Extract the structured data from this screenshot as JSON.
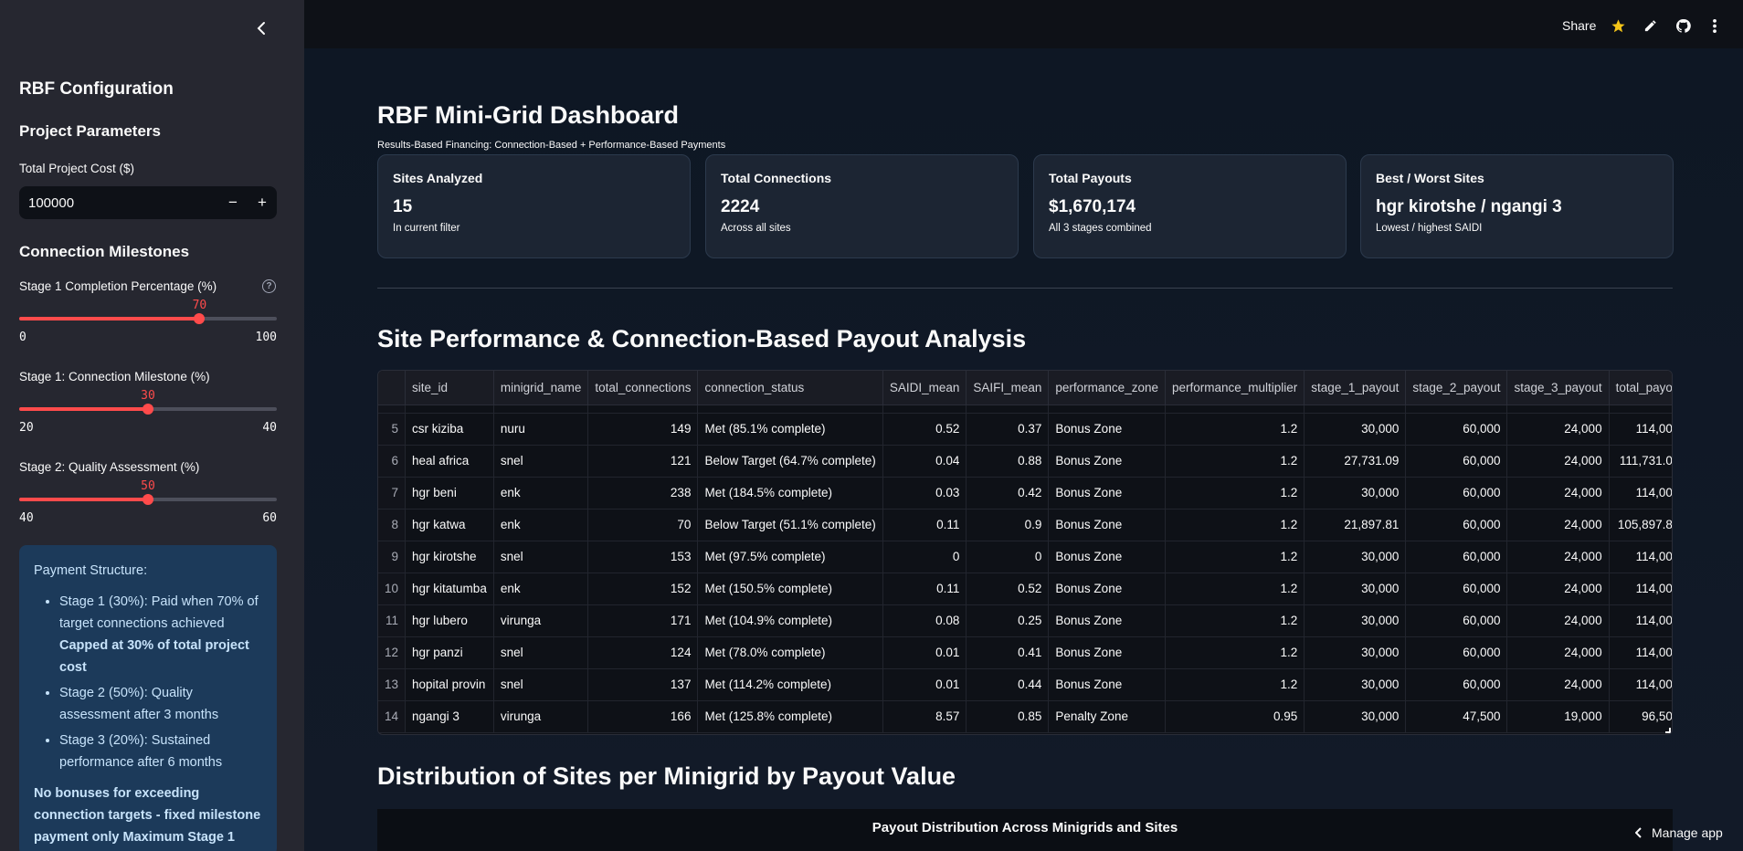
{
  "sidebar": {
    "title": "RBF Configuration",
    "project_params_heading": "Project Parameters",
    "total_cost_label": "Total Project Cost ($)",
    "total_cost_value": "100000",
    "stepper_minus": "−",
    "stepper_plus": "+",
    "milestones_heading": "Connection Milestones",
    "help_icon_glyph": "?",
    "sliders": [
      {
        "label": "Stage 1 Completion Percentage (%)",
        "value": "70",
        "min": "0",
        "max": "100",
        "fraction": 0.7
      },
      {
        "label": "Stage 1: Connection Milestone (%)",
        "value": "30",
        "min": "20",
        "max": "40",
        "fraction": 0.5
      },
      {
        "label": "Stage 2: Quality Assessment (%)",
        "value": "50",
        "min": "40",
        "max": "60",
        "fraction": 0.5
      }
    ],
    "payment": {
      "title": "Payment Structure:",
      "items": [
        {
          "text": "Stage 1 (30%): Paid when 70% of target connections achieved",
          "bold": "Capped at 30% of total project cost"
        },
        {
          "text": "Stage 2 (50%): Quality assessment after 3 months",
          "bold": ""
        },
        {
          "text": "Stage 3 (20%): Sustained performance after 6 months",
          "bold": ""
        }
      ],
      "note": "No bonuses for exceeding connection targets - fixed milestone payment only Maximum Stage 1"
    }
  },
  "topbar": {
    "share": "Share",
    "icons": [
      "star-icon",
      "edit-icon",
      "github-icon",
      "more-icon"
    ]
  },
  "main": {
    "title": "RBF Mini-Grid Dashboard",
    "subtitle": "Results-Based Financing: Connection-Based + Performance-Based Payments",
    "metrics": [
      {
        "label": "Sites Analyzed",
        "value": "15",
        "note": "In current filter"
      },
      {
        "label": "Total Connections",
        "value": "2224",
        "note": "Across all sites"
      },
      {
        "label": "Total Payouts",
        "value": "$1,670,174",
        "note": "All 3 stages combined"
      },
      {
        "label": "Best / Worst Sites",
        "value": "hgr kirotshe / ngangi 3",
        "note": "Lowest / highest SAIDI"
      }
    ],
    "section_table_title": "Site Performance & Connection-Based Payout Analysis",
    "section_dist_title": "Distribution of Sites per Minigrid by Payout Value",
    "chart_title": "Payout Distribution Across Minigrids and Sites",
    "manage_app": "Manage app"
  },
  "table": {
    "columns": [
      "",
      "site_id",
      "minigrid_name",
      "total_connections",
      "connection_status",
      "SAIDI_mean",
      "SAIFI_mean",
      "performance_zone",
      "performance_multiplier",
      "stage_1_payout",
      "stage_2_payout",
      "stage_3_payout",
      "total_payo"
    ],
    "rows": [
      [
        "5",
        "csr kiziba",
        "nuru",
        "149",
        "Met (85.1% complete)",
        "0.52",
        "0.37",
        "Bonus Zone",
        "1.2",
        "30,000",
        "60,000",
        "24,000",
        "114,00"
      ],
      [
        "6",
        "heal africa",
        "snel",
        "121",
        "Below Target (64.7% complete)",
        "0.04",
        "0.88",
        "Bonus Zone",
        "1.2",
        "27,731.09",
        "60,000",
        "24,000",
        "111,731.0"
      ],
      [
        "7",
        "hgr beni",
        "enk",
        "238",
        "Met (184.5% complete)",
        "0.03",
        "0.42",
        "Bonus Zone",
        "1.2",
        "30,000",
        "60,000",
        "24,000",
        "114,00"
      ],
      [
        "8",
        "hgr katwa",
        "enk",
        "70",
        "Below Target (51.1% complete)",
        "0.11",
        "0.9",
        "Bonus Zone",
        "1.2",
        "21,897.81",
        "60,000",
        "24,000",
        "105,897.8"
      ],
      [
        "9",
        "hgr kirotshe",
        "snel",
        "153",
        "Met (97.5% complete)",
        "0",
        "0",
        "Bonus Zone",
        "1.2",
        "30,000",
        "60,000",
        "24,000",
        "114,00"
      ],
      [
        "10",
        "hgr kitatumba",
        "enk",
        "152",
        "Met (150.5% complete)",
        "0.11",
        "0.52",
        "Bonus Zone",
        "1.2",
        "30,000",
        "60,000",
        "24,000",
        "114,00"
      ],
      [
        "11",
        "hgr lubero",
        "virunga",
        "171",
        "Met (104.9% complete)",
        "0.08",
        "0.25",
        "Bonus Zone",
        "1.2",
        "30,000",
        "60,000",
        "24,000",
        "114,00"
      ],
      [
        "12",
        "hgr panzi",
        "snel",
        "124",
        "Met (78.0% complete)",
        "0.01",
        "0.41",
        "Bonus Zone",
        "1.2",
        "30,000",
        "60,000",
        "24,000",
        "114,00"
      ],
      [
        "13",
        "hopital provin",
        "snel",
        "137",
        "Met (114.2% complete)",
        "0.01",
        "0.44",
        "Bonus Zone",
        "1.2",
        "30,000",
        "60,000",
        "24,000",
        "114,00"
      ],
      [
        "14",
        "ngangi 3",
        "virunga",
        "166",
        "Met (125.8% complete)",
        "8.57",
        "0.85",
        "Penalty Zone",
        "0.95",
        "30,000",
        "47,500",
        "19,000",
        "96,50"
      ]
    ]
  }
}
